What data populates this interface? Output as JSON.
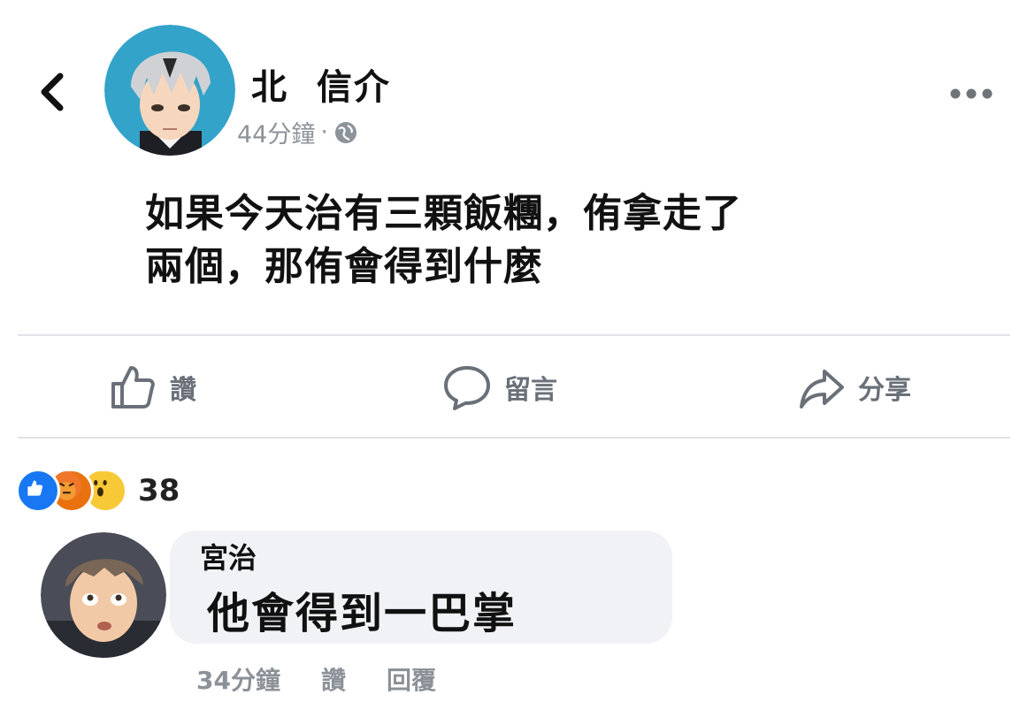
{
  "post": {
    "author_name": "北  信介",
    "timestamp": "44分鐘",
    "separator": "·",
    "text_line1": "如果今天治有三顆飯糰，侑拿走了",
    "text_line2": "兩個，那侑會得到什麼"
  },
  "actions": {
    "like": "讚",
    "comment": "留言",
    "share": "分享"
  },
  "reactions": {
    "count": "38",
    "types": [
      "like",
      "angry",
      "wow"
    ]
  },
  "comment": {
    "author_name": "宮治",
    "text": "他會得到一巴掌",
    "timestamp": "34分鐘",
    "like_label": "讚",
    "reply_label": "回覆"
  },
  "colors": {
    "like_blue": "#1877f2",
    "muted_text": "#8d939a",
    "bubble_bg": "#f0f2f6",
    "divider": "#e2e4e8"
  }
}
